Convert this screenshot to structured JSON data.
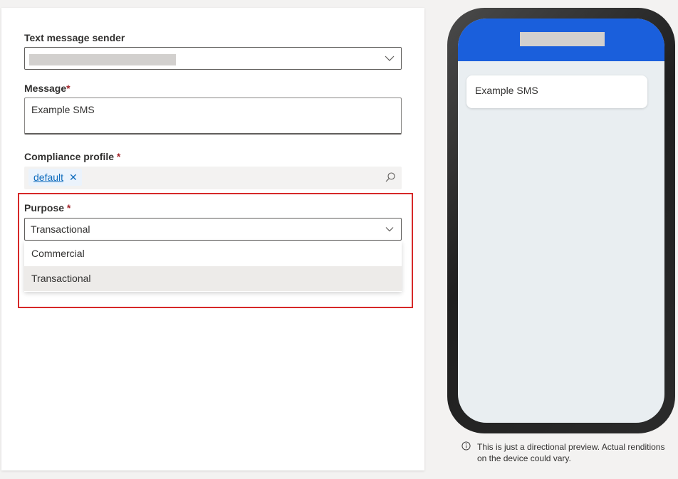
{
  "form": {
    "sender": {
      "label": "Text message sender",
      "value": ""
    },
    "message": {
      "label": "Message",
      "required_mark": "*",
      "value": "Example SMS"
    },
    "compliance": {
      "label": "Compliance profile",
      "required_mark": "*",
      "tag": "default",
      "remove_glyph": "✕",
      "icon": "search-icon"
    },
    "purpose": {
      "label": "Purpose",
      "required_mark": "*",
      "selected": "Transactional",
      "options": [
        {
          "label": "Commercial"
        },
        {
          "label": "Transactional"
        }
      ]
    }
  },
  "preview": {
    "message": "Example SMS",
    "note": "This is just a directional preview. Actual renditions on the device could vary.",
    "note_icon": "info-icon"
  },
  "colors": {
    "accent": "#0f6cbd",
    "phone_header": "#1a5fdc",
    "highlight": "#d62828",
    "required": "#a4262c"
  }
}
